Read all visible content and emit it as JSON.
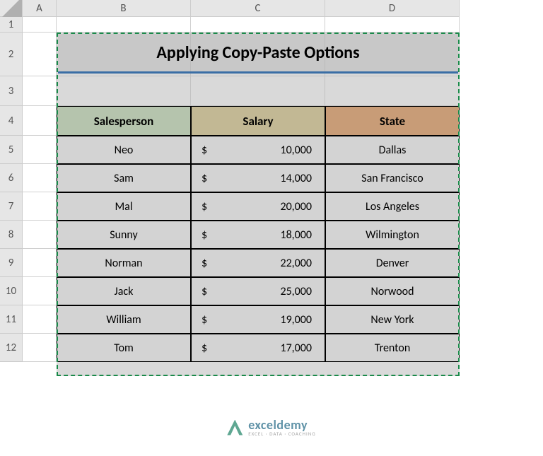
{
  "columns": [
    "A",
    "B",
    "C",
    "D"
  ],
  "rows": [
    "1",
    "2",
    "3",
    "4",
    "5",
    "6",
    "7",
    "8",
    "9",
    "10",
    "11",
    "12"
  ],
  "title": "Applying Copy-Paste Options",
  "headers": {
    "b": "Salesperson",
    "c": "Salary",
    "d": "State"
  },
  "currency": "$",
  "chart_data": {
    "type": "table",
    "columns": [
      "Salesperson",
      "Salary",
      "State"
    ],
    "rows": [
      {
        "salesperson": "Neo",
        "salary": 10000,
        "salary_display": "10,000",
        "state": "Dallas"
      },
      {
        "salesperson": "Sam",
        "salary": 14000,
        "salary_display": "14,000",
        "state": "San Francisco"
      },
      {
        "salesperson": "Mal",
        "salary": 20000,
        "salary_display": "20,000",
        "state": "Los Angeles"
      },
      {
        "salesperson": "Sunny",
        "salary": 18000,
        "salary_display": "18,000",
        "state": "Wilmington"
      },
      {
        "salesperson": "Norman",
        "salary": 22000,
        "salary_display": "22,000",
        "state": "Denver"
      },
      {
        "salesperson": "Jack",
        "salary": 25000,
        "salary_display": "25,000",
        "state": "Norwood"
      },
      {
        "salesperson": "William",
        "salary": 19000,
        "salary_display": "19,000",
        "state": "New York"
      },
      {
        "salesperson": "Tom",
        "salary": 17000,
        "salary_display": "17,000",
        "state": "Trenton"
      }
    ]
  },
  "watermark": {
    "main": "exceldemy",
    "sub": "EXCEL · DATA · COACHING"
  }
}
